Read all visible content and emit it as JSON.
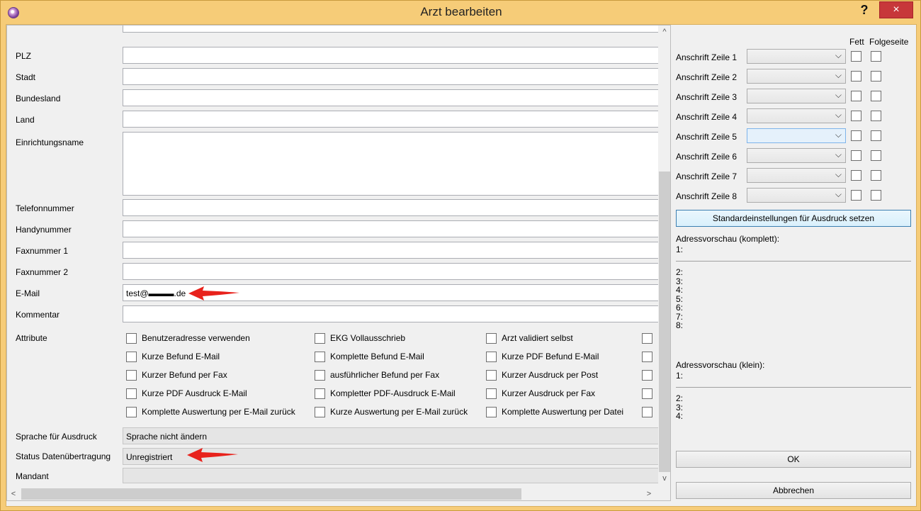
{
  "window": {
    "title": "Arzt bearbeiten",
    "help_label": "?",
    "close_label": "×"
  },
  "form": {
    "fields": [
      {
        "label": "PLZ",
        "value": ""
      },
      {
        "label": "Stadt",
        "value": ""
      },
      {
        "label": "Bundesland",
        "value": ""
      },
      {
        "label": "Land",
        "value": ""
      },
      {
        "label": "Einrichtungsname",
        "value": ""
      },
      {
        "label": "Telefonnummer",
        "value": ""
      },
      {
        "label": "Handynummer",
        "value": ""
      },
      {
        "label": "Faxnummer 1",
        "value": ""
      },
      {
        "label": "Faxnummer 2",
        "value": ""
      },
      {
        "label": "E-Mail",
        "value": "test@▬▬▬.de"
      },
      {
        "label": "Kommentar",
        "value": ""
      }
    ],
    "attribute_label": "Attribute",
    "attributes": [
      [
        "Benutzeradresse verwenden",
        "EKG Vollausschrieb",
        "Arzt validiert selbst"
      ],
      [
        "Kurze Befund E-Mail",
        "Komplette Befund E-Mail",
        "Kurze PDF Befund E-Mail"
      ],
      [
        "Kurzer Befund per Fax",
        "ausführlicher Befund per Fax",
        "Kurzer Ausdruck per Post"
      ],
      [
        "Kurze PDF Ausdruck E-Mail",
        "Kompletter PDF-Ausdruck E-Mail",
        "Kurzer Ausdruck per Fax"
      ],
      [
        "Komplette Auswertung per E-Mail zurück",
        "Kurze Auswertung per E-Mail zurück",
        "Komplette Auswertung per Datei"
      ]
    ],
    "language": {
      "label": "Sprache für Ausdruck",
      "value": "Sprache nicht ändern"
    },
    "status": {
      "label": "Status Datenübertragung",
      "value": "Unregistriert"
    },
    "mandant": {
      "label": "Mandant",
      "value": ""
    }
  },
  "scroll": {
    "up": "^",
    "down": "v",
    "left": "<",
    "right": ">"
  },
  "right": {
    "fett_label": "Fett",
    "folgeseite_label": "Folgeseite",
    "lines": [
      "Anschrift Zeile 1",
      "Anschrift Zeile 2",
      "Anschrift Zeile 3",
      "Anschrift Zeile 4",
      "Anschrift Zeile 5",
      "Anschrift Zeile 6",
      "Anschrift Zeile 7",
      "Anschrift Zeile 8"
    ],
    "defaults_button": "Standardeinstellungen für Ausdruck setzen",
    "preview_full_title": "Adressvorschau (komplett):",
    "preview_full_first": "1:",
    "preview_full_rest": "2:\n3:\n4:\n5:\n6:\n7:\n8:",
    "preview_small_title": "Adressvorschau (klein):",
    "preview_small_first": "1:",
    "preview_small_rest": "2:\n3:\n4:",
    "ok_button": "OK",
    "cancel_button": "Abbrechen"
  },
  "colors": {
    "title_bar": "#f6cc78",
    "close_button": "#c7373a",
    "annotation_arrow": "#e8221c",
    "focused_combo": "#e5f1fb"
  }
}
